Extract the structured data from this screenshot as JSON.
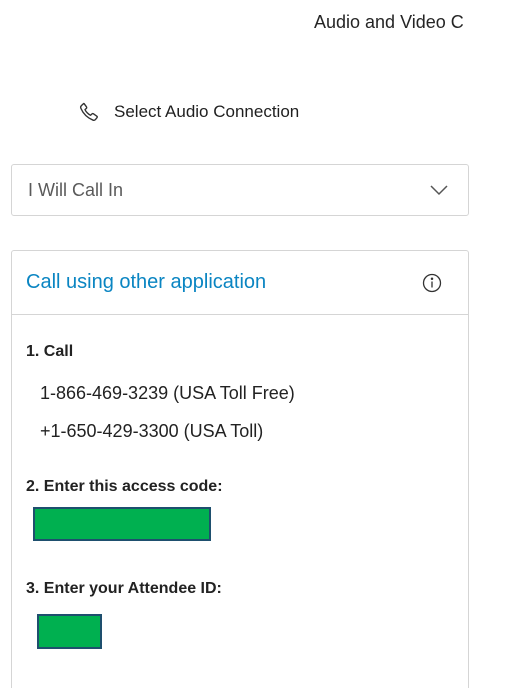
{
  "window": {
    "title": "Audio and Video C"
  },
  "audio_connection": {
    "icon": "phone-icon",
    "label": "Select Audio Connection"
  },
  "audio_select": {
    "value": "I Will Call In",
    "icon": "chevron-down-icon"
  },
  "call_panel": {
    "title": "Call using other application",
    "info_icon": "info-icon",
    "step1_label": "1. Call",
    "numbers": [
      "1-866-469-3239 (USA Toll Free)",
      "+1-650-429-3300 (USA Toll)"
    ],
    "step2_label": "2. Enter this access code:",
    "step3_label": "3. Enter your Attendee ID:",
    "redaction_color": "#00b050"
  }
}
